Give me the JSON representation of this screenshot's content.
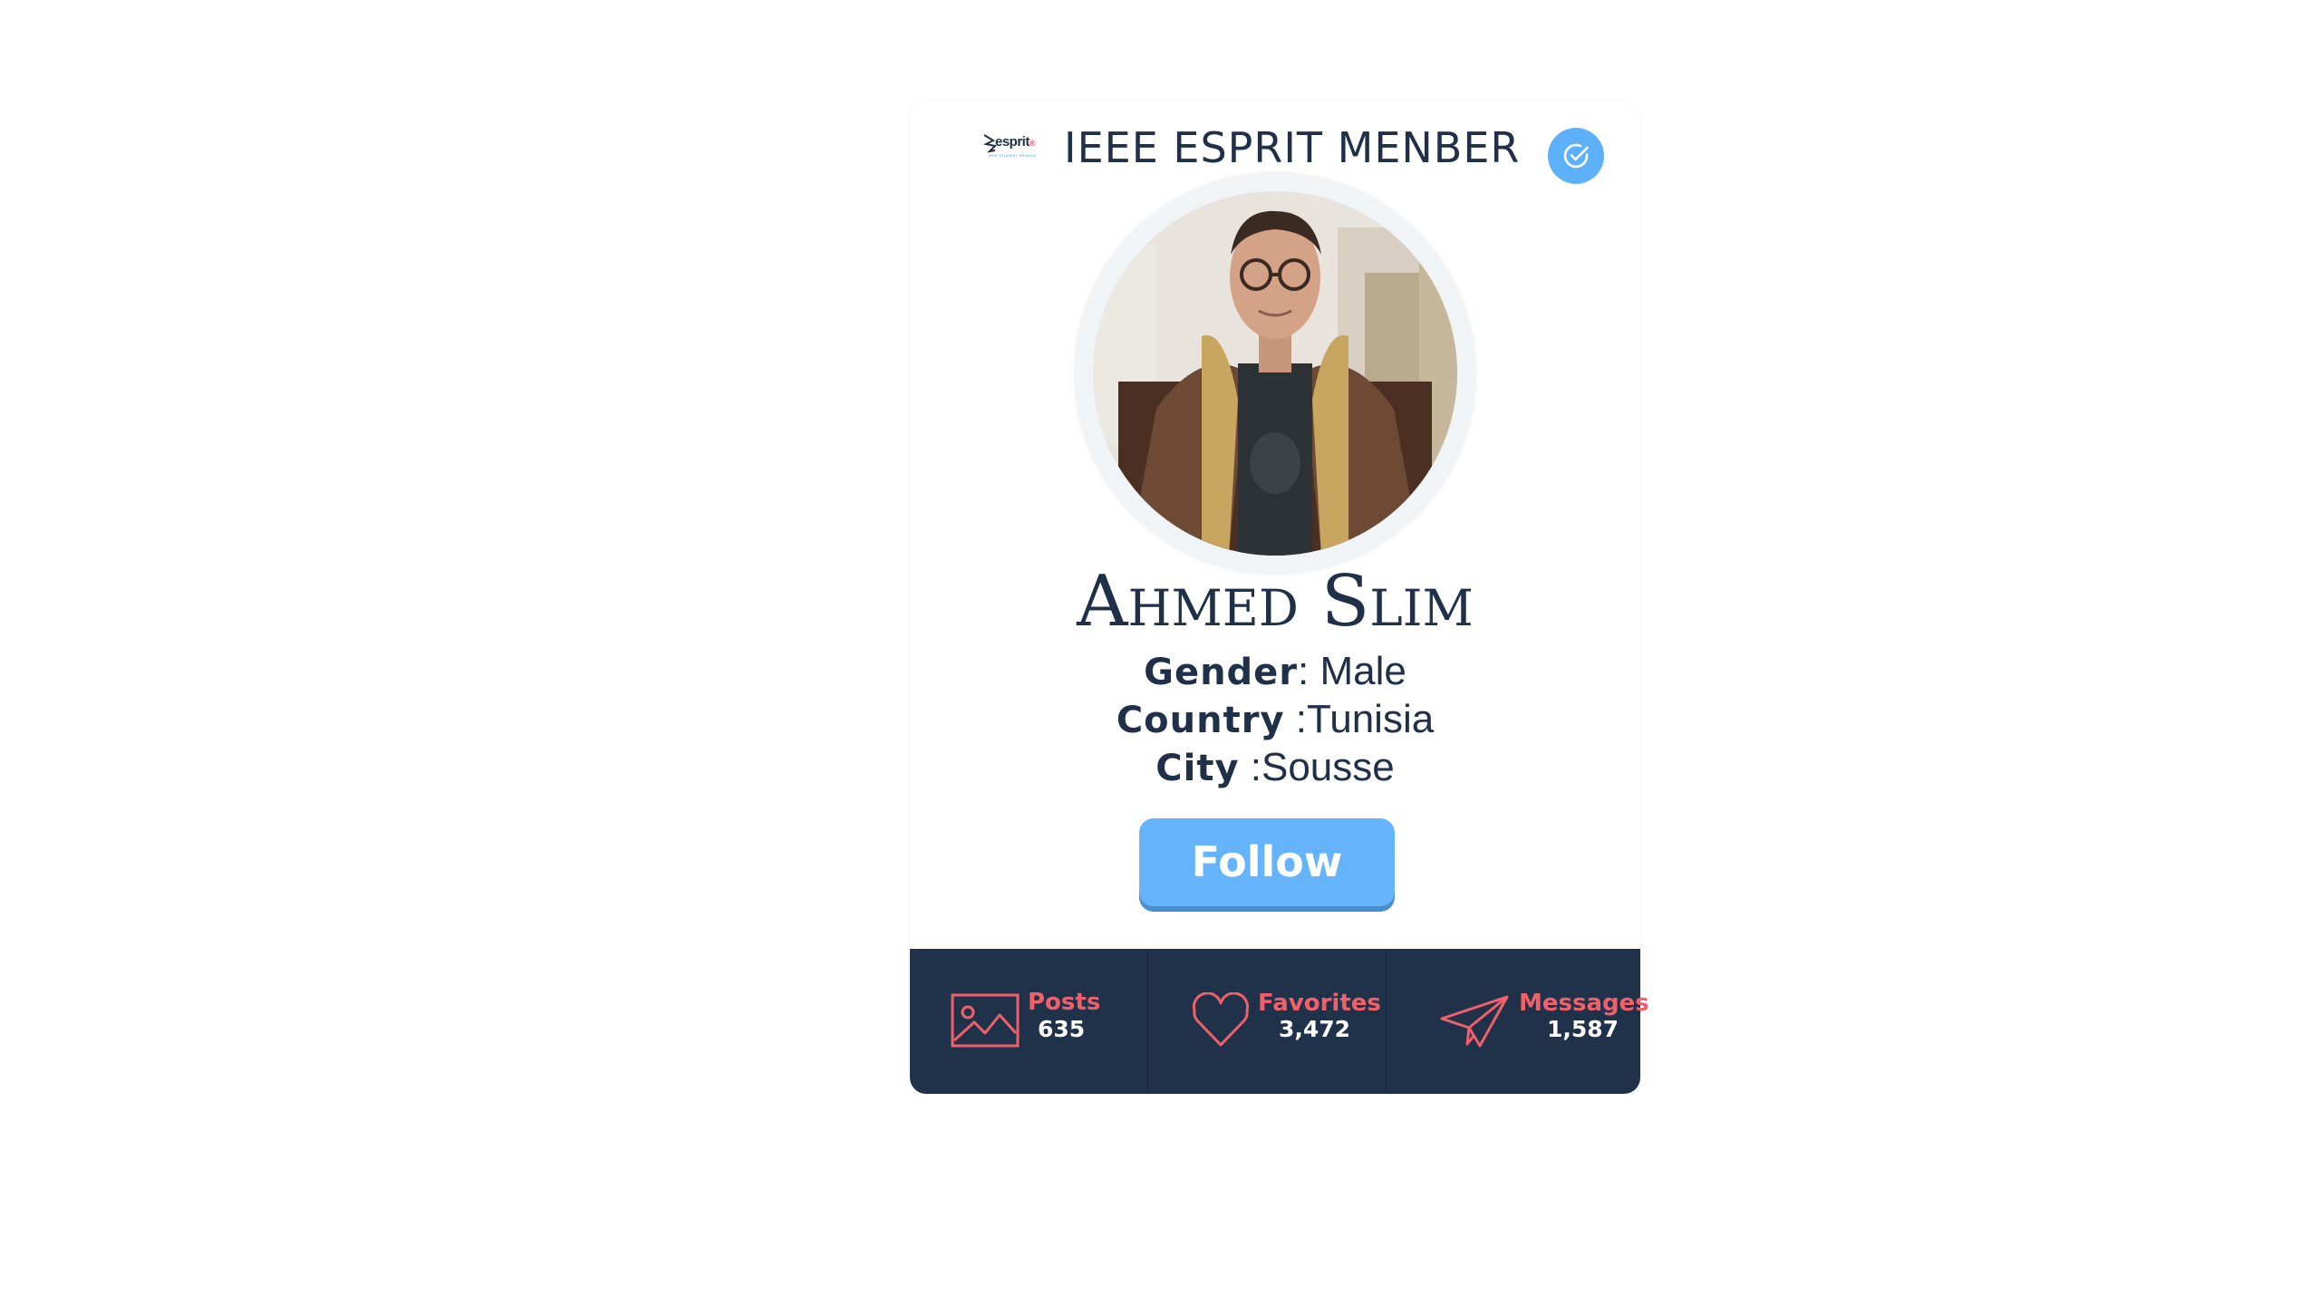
{
  "header": {
    "logo_name": "esprit",
    "logo_mark": "®",
    "logo_subtitle": "IEEE STUDENT BRANCH",
    "title": "IEEE ESPRIT MENBER",
    "badge_icon": "check-circle-icon"
  },
  "profile": {
    "name": "Ahmed Slim",
    "gender_label": "Gender",
    "gender_value": ": Male",
    "country_label": "Country",
    "country_value": " :Tunisia",
    "city_label": "City",
    "city_value": " :Sousse",
    "photo_alt": "Profile photo"
  },
  "follow_button": {
    "label": "Follow"
  },
  "stats": [
    {
      "label": "Posts",
      "count": "635",
      "icon": "image-icon"
    },
    {
      "label": "Favorites",
      "count": "3,472",
      "icon": "heart-icon"
    },
    {
      "label": "Messages",
      "count": "1,587",
      "icon": "paper-plane-icon"
    }
  ],
  "colors": {
    "navy": "#20324a",
    "accent_blue": "#64b3fb",
    "stat_red": "#f0606a",
    "text_dark": "#1f3048"
  }
}
